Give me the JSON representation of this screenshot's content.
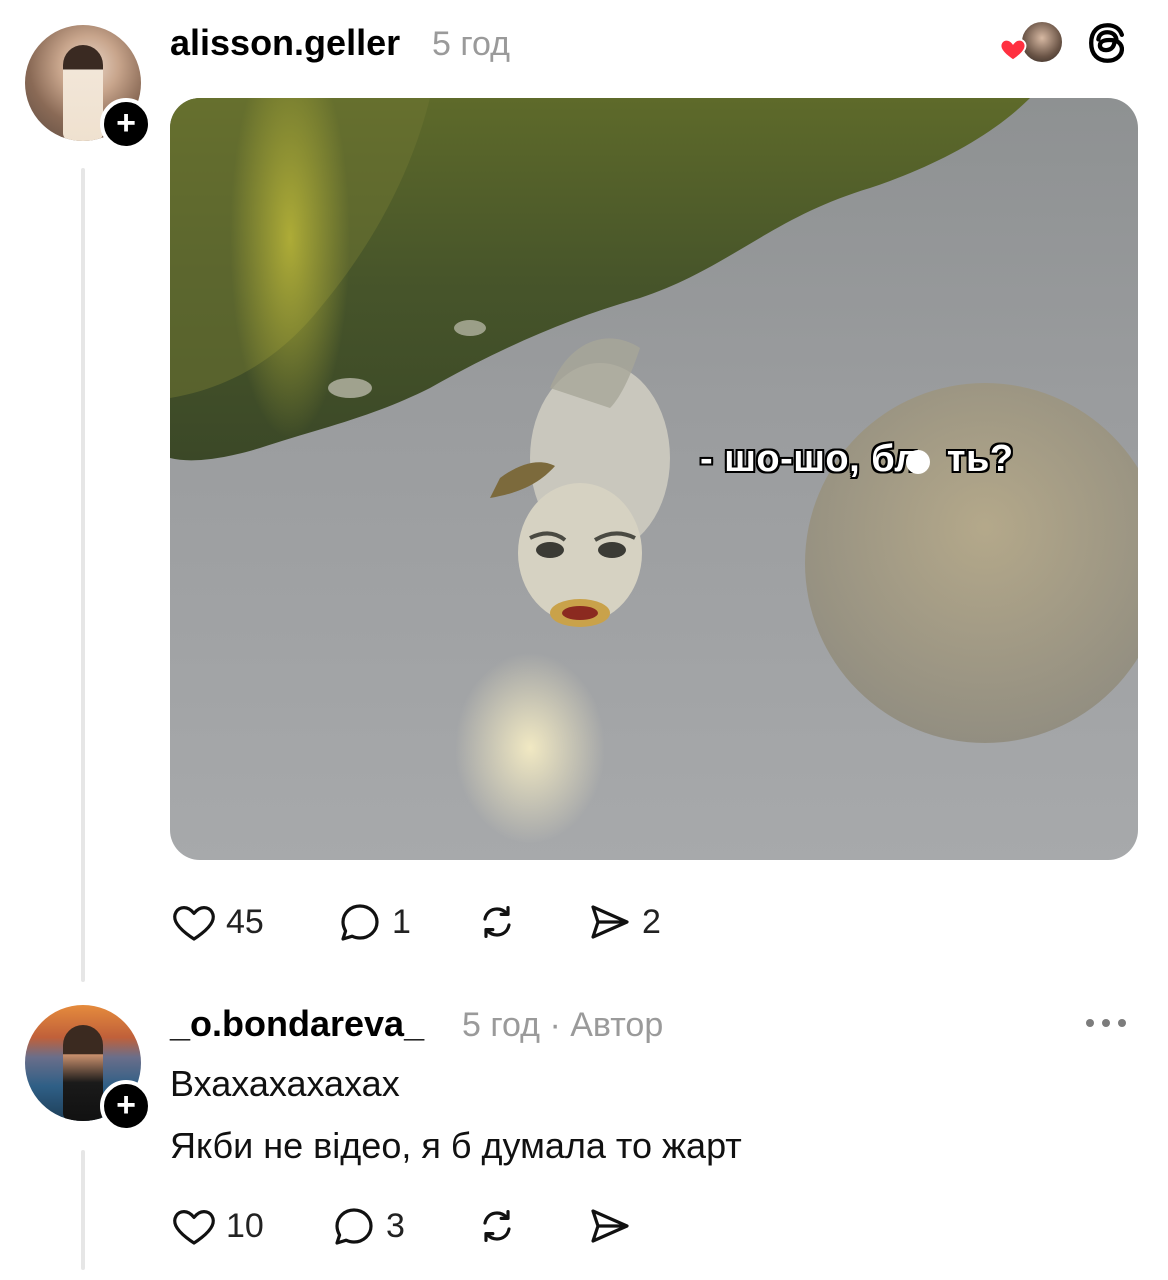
{
  "post": {
    "username": "alisson.geller",
    "time": "5 год",
    "media_caption": "- шо-шо, бл",
    "media_caption_end": "ть?",
    "actions": {
      "like_count": "45",
      "reply_count": "1",
      "share_count": "2"
    }
  },
  "reply": {
    "username": "_o.bondareva_",
    "meta": "5 год · Автор",
    "line1": "Вхахахахахах",
    "line2": "Якби не відео, я б думала то жарт",
    "actions": {
      "like_count": "10",
      "reply_count": "3"
    }
  },
  "icons": {
    "follow": "plus-icon",
    "like": "heart-outline-icon",
    "reply": "speech-bubble-icon",
    "repost": "repost-icon",
    "share": "send-icon",
    "more": "more-horizontal-icon",
    "brand": "threads-logo-icon",
    "reaction": "heart-filled-icon"
  },
  "colors": {
    "reaction_heart": "#ff3040",
    "muted_text": "#9a9a9a",
    "thread_line": "#e6e6e6"
  }
}
